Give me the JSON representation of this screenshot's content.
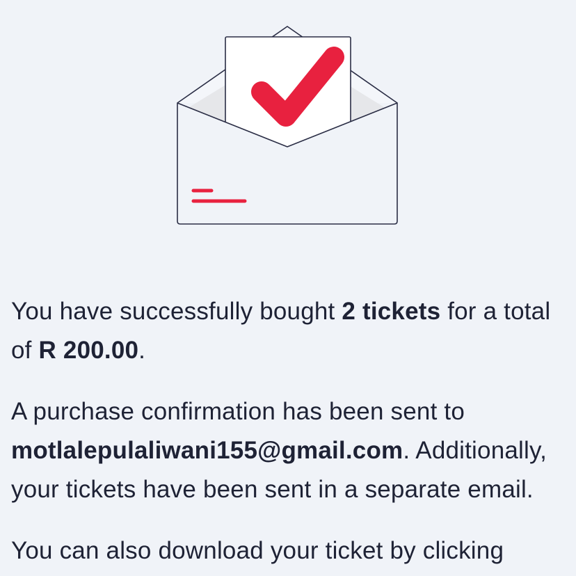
{
  "illustration": {
    "icon": "envelope-with-checkmark-icon",
    "accent_color": "#e8213f",
    "outline_color": "#2a2d45"
  },
  "message": {
    "p1_prefix": "You have successfully bought ",
    "p1_tickets": "2 tickets",
    "p1_middle": " for a total of ",
    "p1_amount": "R 200.00",
    "p1_suffix": ".",
    "p2_prefix": "A purchase confirmation has been sent to ",
    "p2_email": "motlalepulaliwani155@gmail.com",
    "p2_suffix": ". Additionally, your tickets have been sent in a separate email.",
    "p3_text": "You can also download your ticket by clicking"
  }
}
